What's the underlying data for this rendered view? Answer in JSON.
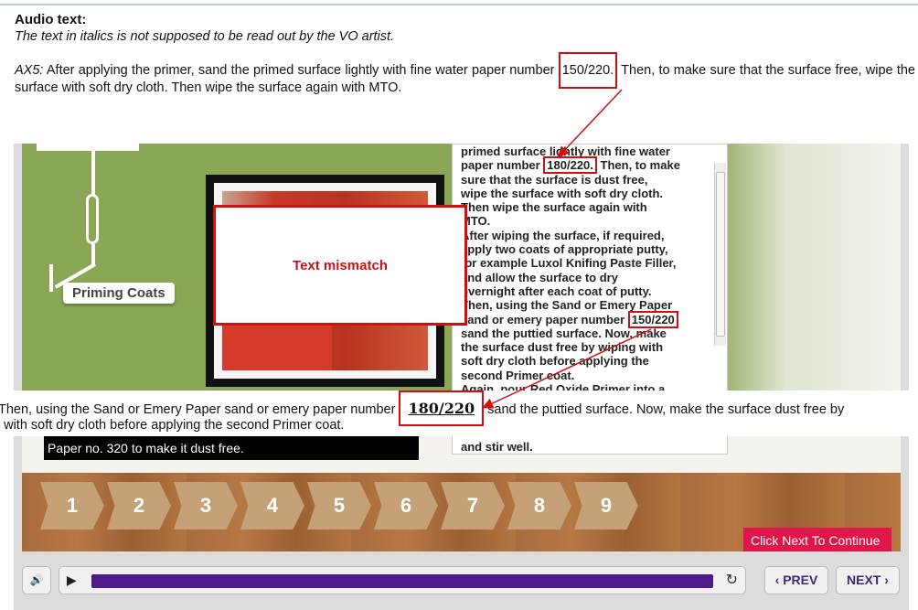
{
  "audio": {
    "title": "Audio text:",
    "note": "The text in italics is not supposed to be read out by the VO artist.",
    "ax_label": "AX5:",
    "para_before": " After applying the primer, sand the primed surface lightly with fine water paper number ",
    "highlight": "150/220.",
    "para_after": " Then, to make sure that the surface free, wipe the surface with soft dry cloth. Then wipe the surface again with MTO."
  },
  "slide": {
    "priming_label": "Priming Coats",
    "panel_lines": [
      "primed surface lightly with fine water",
      "paper number ",
      "sure that the surface is dust free,",
      "wipe the surface with soft dry cloth.",
      "Then wipe the surface again with",
      "MTO.",
      "After wiping the surface, if required,",
      "apply two coats of appropriate putty,",
      "for example Luxol Knifing Paste Filler,",
      "and allow the surface to dry",
      "overnight after each coat of putty.",
      "Then, using the Sand or Emery Paper",
      "sand or emery paper number ",
      "sand the puttied surface. Now, make",
      "the surface dust free by wiping with",
      "soft dry cloth before applying the",
      "second Primer coat.",
      "Again, pour Red Oxide Primer into a"
    ],
    "panel_hl1": "180/220.",
    "panel_after_hl1": " Then, to make",
    "panel_hl2": "150/220",
    "caption": "Paper no. 320 to make it dust free.",
    "caption_more": "and stir well.",
    "steps": [
      "1",
      "2",
      "3",
      "4",
      "5",
      "6",
      "7",
      "8",
      "9"
    ],
    "next_cta": "Click Next To Continue"
  },
  "annotation": {
    "mismatch": "Text mismatch",
    "strip_l1_before": "Then, using the Sand or Emery Paper sand or emery paper number ",
    "strip_hl": "180/220",
    "strip_l1_after": " sand the puttied surface.  Now, make the surface dust free by",
    "strip_l2": "g with soft dry cloth before applying the second Primer coat."
  },
  "controls": {
    "volume_icon": "speaker-icon",
    "play_icon": "play-icon",
    "replay_icon": "replay-icon",
    "progress": 1.0,
    "prev_label": "PREV",
    "next_label": "NEXT"
  },
  "colors": {
    "annotation_red": "#d01010",
    "stage_green": "#8aa756",
    "progress_purple": "#4d1b8a",
    "cta_pink": "#e0164a"
  }
}
